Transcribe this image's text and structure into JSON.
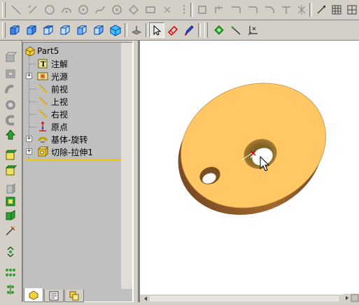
{
  "toolbar_top": {
    "icons": [
      "line-icon",
      "rectangle-icon",
      "circle-icon",
      "arc-icon",
      "centerpoint-arc-icon",
      "tangent-arc-icon",
      "spline-icon",
      "polygon-icon",
      "rectangle-sketch-icon",
      "centerline-icon",
      "offset-icon",
      "trim-icon",
      "extend-icon",
      "fillet-sketch-icon",
      "mirror-icon",
      "dimension-icon",
      "grid-icon",
      "relations-icon"
    ]
  },
  "toolbar_view": {
    "icons": [
      "view-front-icon",
      "view-back-icon",
      "view-left-icon",
      "view-right-icon",
      "view-top-icon",
      "view-bottom-icon",
      "view-isometric-icon",
      "normal-to-icon",
      "select-icon",
      "smart-dimension-icon",
      "sketch-icon",
      "add-relation-icon",
      "centerline-tool-icon",
      "coordinate-icon"
    ]
  },
  "sidebar": {
    "icons": [
      "extruded-boss-icon",
      "revolved-boss-icon",
      "swept-boss-icon",
      "lofted-boss-icon",
      "extruded-cut-icon",
      "revolved-cut-icon",
      "fillet-icon",
      "chamfer-icon",
      "shell-icon",
      "draft-icon",
      "rib-icon",
      "hole-icon",
      "linear-pattern-icon",
      "circular-pattern-icon",
      "mirror-feature-icon"
    ]
  },
  "tree": {
    "root": "Part5",
    "items": [
      {
        "label": "注解",
        "expandable": false,
        "icon": "annotations-icon"
      },
      {
        "label": "光源",
        "expandable": true,
        "icon": "lighting-icon"
      },
      {
        "label": "前视",
        "expandable": false,
        "icon": "plane-icon"
      },
      {
        "label": "上视",
        "expandable": false,
        "icon": "plane-icon"
      },
      {
        "label": "右视",
        "expandable": false,
        "icon": "plane-icon"
      },
      {
        "label": "原点",
        "expandable": false,
        "icon": "origin-icon"
      },
      {
        "label": "基体-旋转",
        "expandable": true,
        "icon": "revolve-feature-icon"
      },
      {
        "label": "切除-拉伸1",
        "expandable": true,
        "icon": "cut-extrude-feature-icon"
      }
    ]
  },
  "tabs": [
    "featuremanager-tab",
    "propertymanager-tab",
    "configurationmanager-tab"
  ],
  "colors": {
    "part_face": "#FFC864",
    "part_edge": "#8B5A2B",
    "rollback_bar": "#F0C800"
  }
}
